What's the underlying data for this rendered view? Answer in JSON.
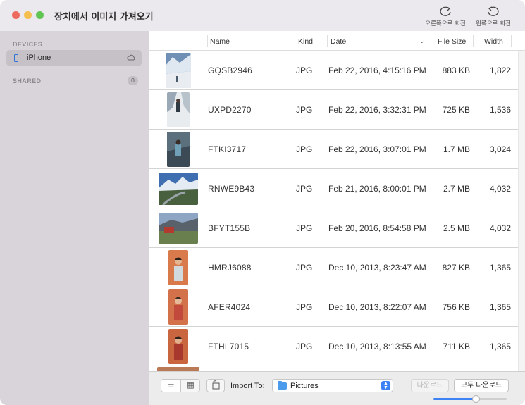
{
  "window": {
    "title": "장치에서 이미지 가져오기",
    "rotate_right_label": "오른쪽으로 회전",
    "rotate_left_label": "왼쪽으로 회전"
  },
  "sidebar": {
    "devices_label": "DEVICES",
    "device_name": "iPhone",
    "shared_label": "SHARED",
    "shared_count": "0"
  },
  "table": {
    "headers": {
      "name": "Name",
      "kind": "Kind",
      "date": "Date",
      "size": "File Size",
      "width": "Width"
    },
    "rows": [
      {
        "name": "GQSB2946",
        "kind": "JPG",
        "date": "Feb 22, 2016, 4:15:16 PM",
        "size": "883 KB",
        "width": "1,822"
      },
      {
        "name": "UXPD2270",
        "kind": "JPG",
        "date": "Feb 22, 2016, 3:32:31 PM",
        "size": "725 KB",
        "width": "1,536"
      },
      {
        "name": "FTKI3717",
        "kind": "JPG",
        "date": "Feb 22, 2016, 3:07:01 PM",
        "size": "1.7 MB",
        "width": "3,024"
      },
      {
        "name": "RNWE9B43",
        "kind": "JPG",
        "date": "Feb 21, 2016, 8:00:01 PM",
        "size": "2.7 MB",
        "width": "4,032"
      },
      {
        "name": "BFYT155B",
        "kind": "JPG",
        "date": "Feb 20, 2016, 8:54:58 PM",
        "size": "2.5 MB",
        "width": "4,032"
      },
      {
        "name": "HMRJ6088",
        "kind": "JPG",
        "date": "Dec 10, 2013, 8:23:47 AM",
        "size": "827 KB",
        "width": "1,365"
      },
      {
        "name": "AFER4024",
        "kind": "JPG",
        "date": "Dec 10, 2013, 8:22:07 AM",
        "size": "756 KB",
        "width": "1,365"
      },
      {
        "name": "FTHL7015",
        "kind": "JPG",
        "date": "Dec 10, 2013, 8:13:55 AM",
        "size": "711 KB",
        "width": "1,365"
      }
    ]
  },
  "footer": {
    "import_to_label": "Import To:",
    "import_destination": "Pictures",
    "download_label": "다운로드",
    "download_all_label": "모두 다운로드",
    "thumbnail_size_fraction": 0.58
  }
}
